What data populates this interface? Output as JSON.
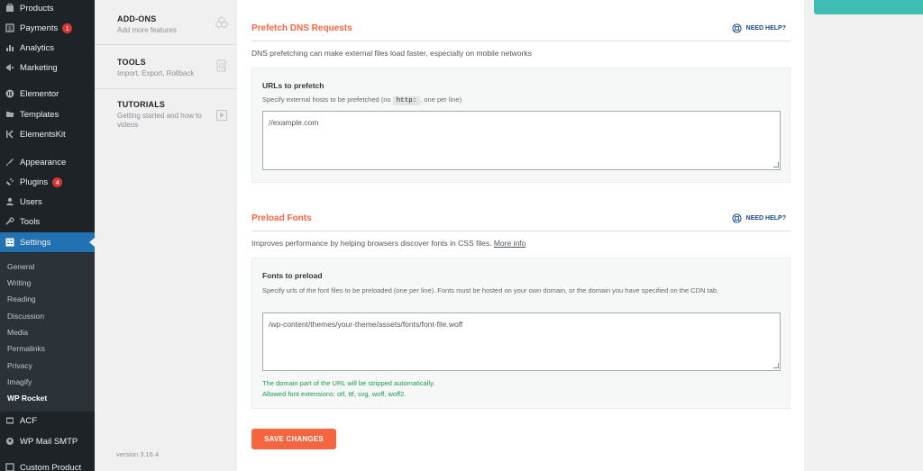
{
  "sidebar": {
    "items": [
      {
        "label": "Products",
        "icon": "products-icon"
      },
      {
        "label": "Payments",
        "icon": "payments-icon",
        "badge": "1"
      },
      {
        "label": "Analytics",
        "icon": "analytics-icon"
      },
      {
        "label": "Marketing",
        "icon": "marketing-icon"
      },
      {
        "label": "Elementor",
        "icon": "elementor-icon"
      },
      {
        "label": "Templates",
        "icon": "templates-icon"
      },
      {
        "label": "ElementsKit",
        "icon": "elementskit-icon"
      },
      {
        "label": "Appearance",
        "icon": "appearance-icon"
      },
      {
        "label": "Plugins",
        "icon": "plugins-icon",
        "badge": "4"
      },
      {
        "label": "Users",
        "icon": "users-icon"
      },
      {
        "label": "Tools",
        "icon": "tools-icon"
      },
      {
        "label": "Settings",
        "icon": "settings-icon"
      },
      {
        "label": "ACF",
        "icon": "acf-icon"
      },
      {
        "label": "WP Mail SMTP",
        "icon": "mail-icon"
      },
      {
        "label": "Custom Product",
        "icon": "custom-product-icon"
      }
    ],
    "submenu": [
      "General",
      "Writing",
      "Reading",
      "Discussion",
      "Media",
      "Permalinks",
      "Privacy",
      "Imagify",
      "WP Rocket"
    ]
  },
  "rocket_nav": {
    "items": [
      {
        "title": "ADD-ONS",
        "desc": "Add more features",
        "icon": "cubes-icon"
      },
      {
        "title": "TOOLS",
        "desc": "Import, Export, Rollback",
        "icon": "import-export-icon"
      },
      {
        "title": "TUTORIALS",
        "desc": "Getting started and how to videos",
        "icon": "video-icon"
      }
    ],
    "version": "version 3.16.4"
  },
  "prefetch": {
    "title": "Prefetch DNS Requests",
    "help": "NEED HELP?",
    "desc": "DNS prefetching can make external files load faster, especially on mobile networks",
    "field_label": "URLs to prefetch",
    "field_help_before": "Specify external hosts to be prefetched (no",
    "field_help_code": "http:",
    "field_help_after": ", one per line)",
    "value": "//example.com"
  },
  "preload": {
    "title": "Preload Fonts",
    "help": "NEED HELP?",
    "desc": "Improves performance by helping browsers discover fonts in CSS files.",
    "more_info": "More info",
    "field_label": "Fonts to preload",
    "field_help": "Specify urls of the font files to be preloaded (one per line). Fonts must be hosted on your own domain, or the domain you have specified on the CDN tab.",
    "value": "/wp-content/themes/your-theme/assets/fonts/font-file.woff",
    "note1": "The domain part of the URL will be stripped automatically.",
    "note2": "Allowed font extensions: otf, ttf, svg, woff, woff2."
  },
  "save_label": "SAVE CHANGES",
  "colors": {
    "accent": "#f56640",
    "help": "#19488f",
    "active_menu": "#2271b1",
    "success": "#1c9b4b",
    "teal": "#40bdb3"
  }
}
